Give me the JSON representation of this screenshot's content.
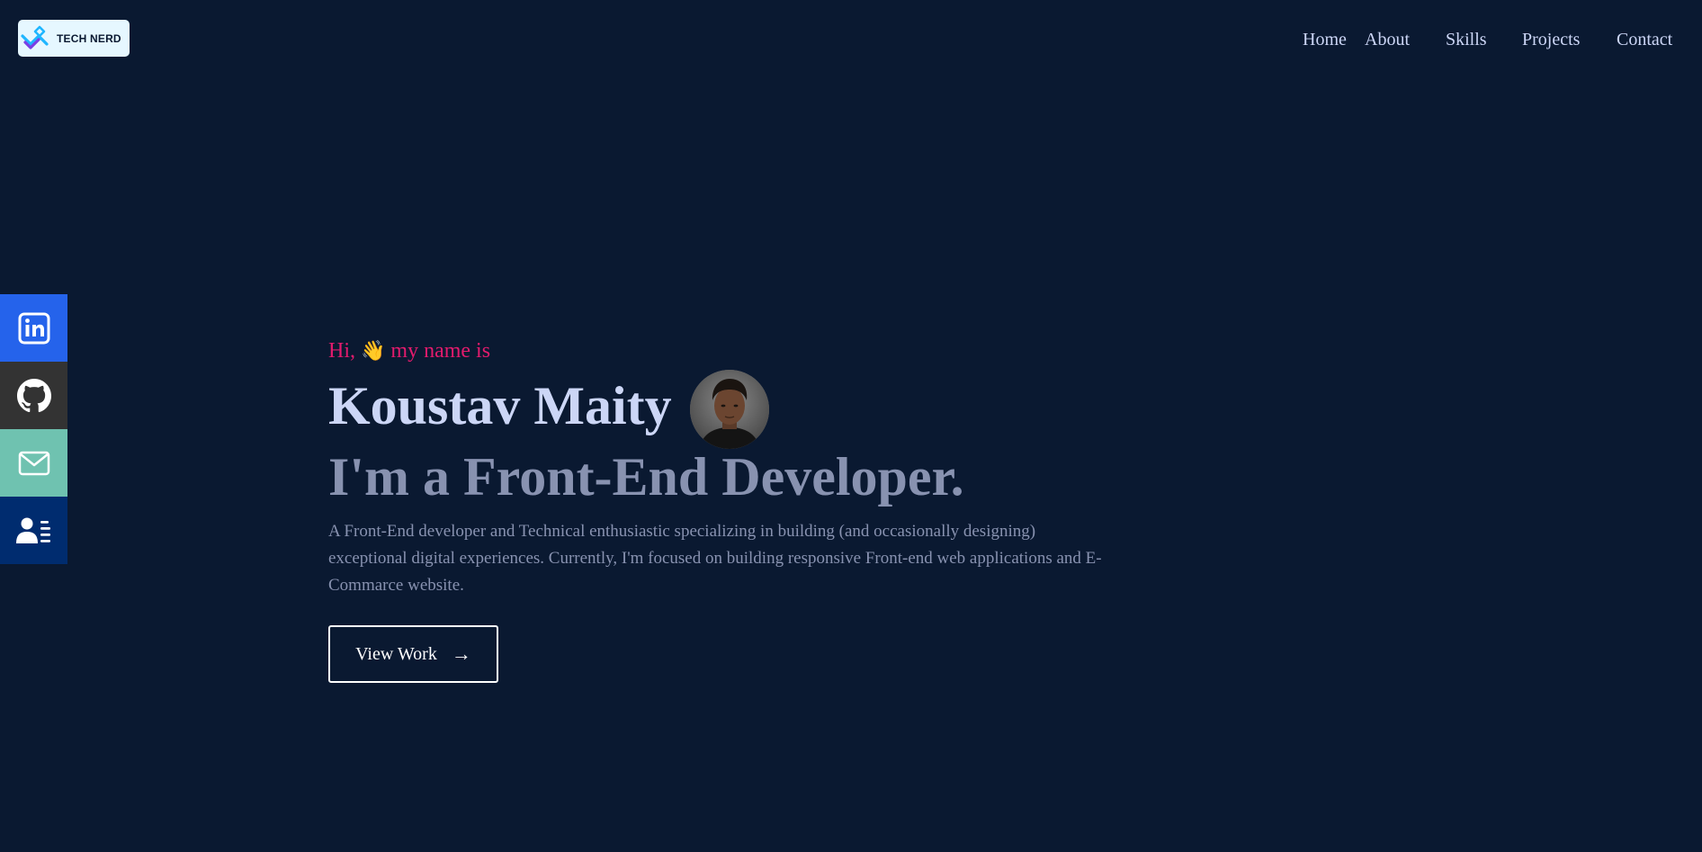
{
  "brand": {
    "logo_text": "TECH NERD"
  },
  "nav": {
    "items": [
      {
        "label": "Home"
      },
      {
        "label": "About"
      },
      {
        "label": "Skills"
      },
      {
        "label": "Projects"
      },
      {
        "label": "Contact"
      }
    ]
  },
  "social": {
    "items": [
      {
        "icon": "linkedin-icon",
        "color": "#2563eb"
      },
      {
        "icon": "github-icon",
        "color": "#333333"
      },
      {
        "icon": "mail-icon",
        "color": "#6fc2b0"
      },
      {
        "icon": "resume-icon",
        "color": "#002c6f"
      }
    ]
  },
  "hero": {
    "greeting_prefix": "Hi,",
    "greeting_emoji": "👋",
    "greeting_suffix": "my name is",
    "name": "Koustav Maity",
    "tagline": "I'm a Front-End Developer.",
    "description": "A Front-End developer and Technical enthusiastic specializing in building (and occasionally designing) exceptional digital experiences. Currently, I'm focused on building responsive Front-end web applications and E-Commarce website.",
    "button_label": "View Work",
    "button_arrow": "→"
  },
  "colors": {
    "background": "#0a1931",
    "heading": "#ccd6f6",
    "muted": "#8892b0",
    "accent": "#e31b6d"
  }
}
